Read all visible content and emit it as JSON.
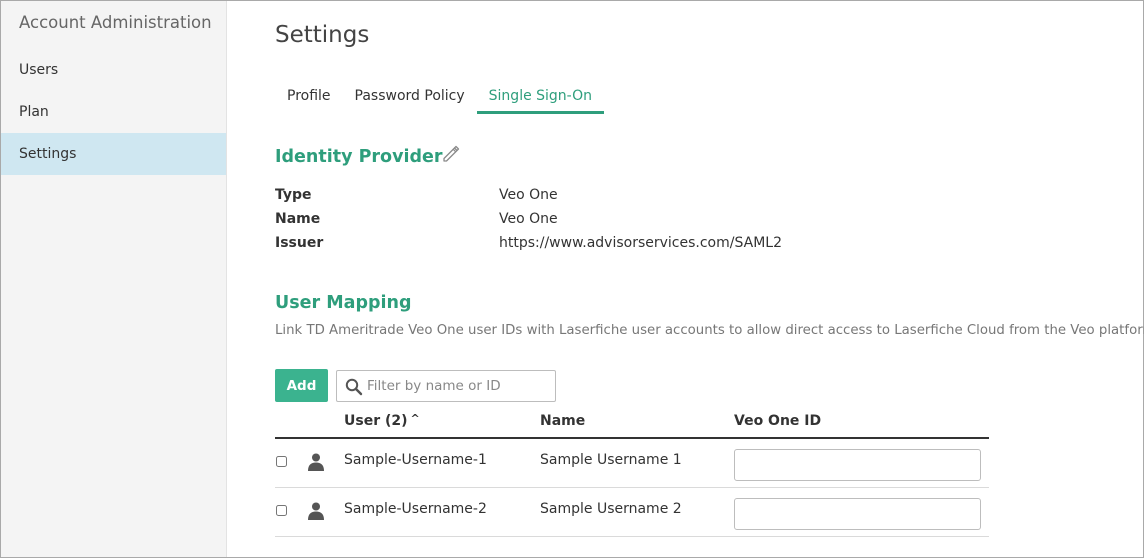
{
  "sidebar": {
    "title": "Account Administration",
    "items": [
      {
        "label": "Users"
      },
      {
        "label": "Plan"
      },
      {
        "label": "Settings"
      }
    ]
  },
  "page": {
    "title": "Settings"
  },
  "tabs": [
    {
      "label": "Profile"
    },
    {
      "label": "Password Policy"
    },
    {
      "label": "Single Sign-On"
    }
  ],
  "identity_provider": {
    "title": "Identity Provider",
    "rows": [
      {
        "label": "Type",
        "value": "Veo One"
      },
      {
        "label": "Name",
        "value": "Veo One"
      },
      {
        "label": "Issuer",
        "value": "https://www.advisorservices.com/SAML2"
      }
    ]
  },
  "user_mapping": {
    "title": "User Mapping",
    "description": "Link TD Ameritrade Veo One user IDs with Laserfiche user accounts to allow direct access to Laserfiche Cloud from the Veo platform.",
    "add_label": "Add",
    "filter_placeholder": "Filter by name or ID",
    "columns": {
      "user": "User (2)",
      "sort_indicator": "^",
      "name": "Name",
      "veo_id": "Veo One ID"
    },
    "rows": [
      {
        "user": "Sample-Username-1",
        "name": "Sample Username 1",
        "veo_id": ""
      },
      {
        "user": "Sample-Username-2",
        "name": "Sample Username 2",
        "veo_id": ""
      }
    ]
  },
  "colors": {
    "accent": "#2e9e7c",
    "button": "#3bb38f",
    "sidebar_active": "#cfe7f1"
  },
  "icons": {
    "edit": "pencil-icon",
    "search": "search-icon",
    "user": "user-icon"
  }
}
